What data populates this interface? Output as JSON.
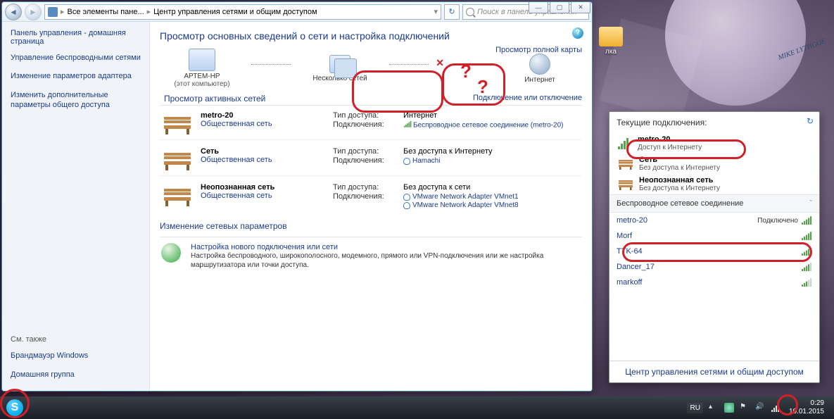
{
  "window": {
    "breadcrumb": {
      "root": "Все элементы пане...",
      "current": "Центр управления сетями и общим доступом"
    },
    "search_placeholder": "Поиск в панели управления",
    "controls": {
      "min": "—",
      "max": "▢",
      "close": "✕"
    }
  },
  "sidebar": {
    "heading": "Панель управления - домашняя страница",
    "links": [
      "Управление беспроводными сетями",
      "Изменение параметров адаптера",
      "Изменить дополнительные параметры общего доступа"
    ],
    "also_label": "См. также",
    "also": [
      "Брандмауэр Windows",
      "Домашняя группа"
    ]
  },
  "content": {
    "title": "Просмотр основных сведений о сети и настройка подключений",
    "full_map_link": "Просмотр полной карты",
    "map": {
      "computer": {
        "name": "АРТЕМ-HP",
        "sub": "(этот компьютер)"
      },
      "multi": {
        "name": "Несколько сетей"
      },
      "internet": {
        "name": "Интернет"
      }
    },
    "active_section": "Просмотр активных сетей",
    "conn_toggle": "Подключение или отключение",
    "access_label": "Тип доступа:",
    "conn_label": "Подключения:",
    "networks": [
      {
        "name": "metro-20",
        "type": "Общественная сеть",
        "access": "Интернет",
        "connections": [
          {
            "kind": "wifi",
            "label": "Беспроводное сетевое соединение (metro-20)"
          }
        ]
      },
      {
        "name": "Сеть",
        "type": "Общественная сеть",
        "access": "Без доступа к Интернету",
        "connections": [
          {
            "kind": "vpn",
            "label": "Hamachi"
          }
        ]
      },
      {
        "name": "Неопознанная сеть",
        "type": "Общественная сеть",
        "access": "Без доступа к сети",
        "connections": [
          {
            "kind": "vpn",
            "label": "VMware Network Adapter VMnet1"
          },
          {
            "kind": "vpn",
            "label": "VMware Network Adapter VMnet8"
          }
        ]
      }
    ],
    "change_section": "Изменение сетевых параметров",
    "setup": {
      "title": "Настройка нового подключения или сети",
      "desc": "Настройка беспроводного, широкополосного, модемного, прямого или VPN-подключения или же настройка маршрутизатора или точки доступа."
    }
  },
  "flyout": {
    "heading": "Текущие подключения:",
    "current": [
      {
        "name": "metro-20",
        "sub": "Доступ к Интернету",
        "icon": "signal"
      },
      {
        "name": "Сеть",
        "sub": "Без доступа к Интернету",
        "icon": "bench"
      },
      {
        "name": "Неопознанная сеть",
        "sub": "Без доступа к Интернету",
        "icon": "bench"
      }
    ],
    "wireless_section": "Беспроводное сетевое соединение",
    "connected_label": "Подключено",
    "wifi": [
      {
        "name": "metro-20",
        "status": "Подключено",
        "bars": 5
      },
      {
        "name": "Morf",
        "status": "",
        "bars": 5
      },
      {
        "name": "TTK-64",
        "status": "",
        "bars": 4
      },
      {
        "name": "Dancer_17",
        "status": "",
        "bars": 4
      },
      {
        "name": "markoff",
        "status": "",
        "bars": 3
      }
    ],
    "bottom_link": "Центр управления сетями и общим доступом"
  },
  "desktop": {
    "folder_label": "лка"
  },
  "taskbar": {
    "lang": "RU",
    "time": "0:29",
    "date": "10.01.2015"
  },
  "signature": "MIKE LYTHGOE"
}
